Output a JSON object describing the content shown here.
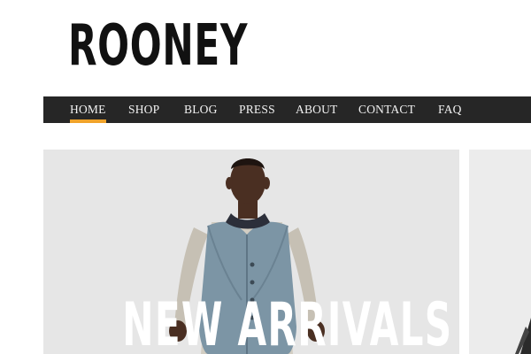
{
  "brand": {
    "logo_text": "ROONEY"
  },
  "nav": {
    "items": [
      {
        "label": "HOME",
        "active": true
      },
      {
        "label": "SHOP",
        "active": false
      },
      {
        "label": "BLOG",
        "active": false
      },
      {
        "label": "PRESS",
        "active": false
      },
      {
        "label": "ABOUT",
        "active": false
      },
      {
        "label": "CONTACT",
        "active": false
      },
      {
        "label": "FAQ",
        "active": false
      }
    ]
  },
  "hero": {
    "title": "NEW ARRIVALS"
  },
  "colors": {
    "nav_bg": "#262626",
    "active_underline": "#f0a32a",
    "hero_bg": "#e6e6e6"
  }
}
